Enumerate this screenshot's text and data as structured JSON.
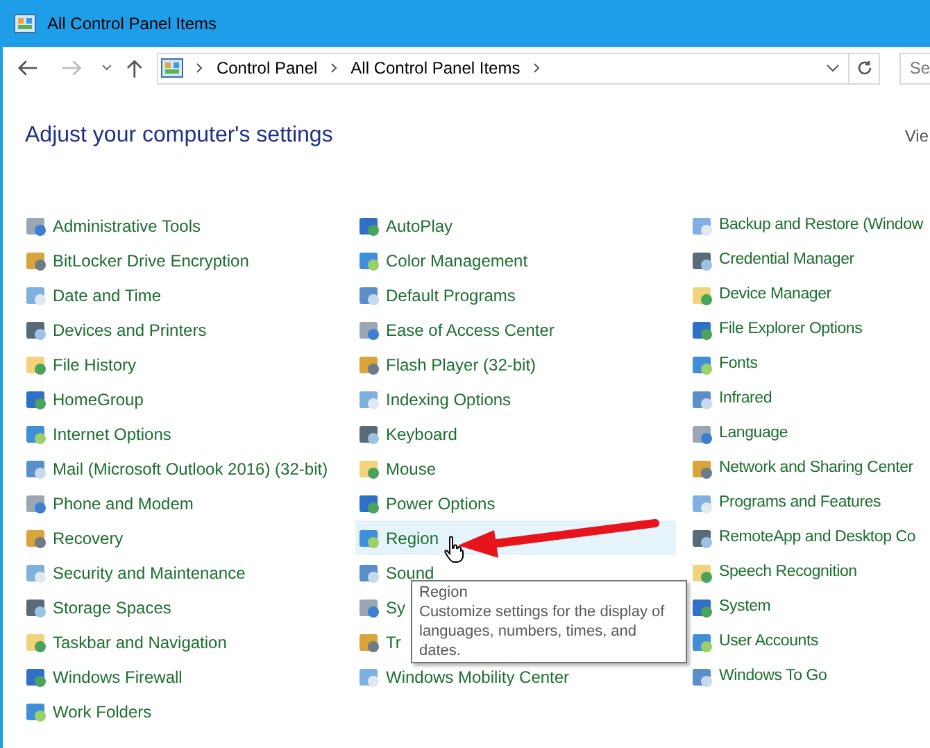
{
  "window": {
    "title": "All Control Panel Items"
  },
  "address_bar": {
    "breadcrumbs": [
      "Control Panel",
      "All Control Panel Items"
    ]
  },
  "search": {
    "placeholder": "Se"
  },
  "heading": "Adjust your computer's settings",
  "view_by": "Vie",
  "columns": [
    [
      {
        "label": "Administrative Tools",
        "selected": false
      },
      {
        "label": "BitLocker Drive Encryption",
        "selected": false
      },
      {
        "label": "Date and Time",
        "selected": false
      },
      {
        "label": "Devices and Printers",
        "selected": false
      },
      {
        "label": "File History",
        "selected": false
      },
      {
        "label": "HomeGroup",
        "selected": false
      },
      {
        "label": "Internet Options",
        "selected": false
      },
      {
        "label": "Mail (Microsoft Outlook 2016) (32-bit)",
        "selected": false
      },
      {
        "label": "Phone and Modem",
        "selected": false
      },
      {
        "label": "Recovery",
        "selected": false
      },
      {
        "label": "Security and Maintenance",
        "selected": false
      },
      {
        "label": "Storage Spaces",
        "selected": false
      },
      {
        "label": "Taskbar and Navigation",
        "selected": false
      },
      {
        "label": "Windows Firewall",
        "selected": false
      },
      {
        "label": "Work Folders",
        "selected": false
      }
    ],
    [
      {
        "label": "AutoPlay",
        "selected": false
      },
      {
        "label": "Color Management",
        "selected": false
      },
      {
        "label": "Default Programs",
        "selected": false
      },
      {
        "label": "Ease of Access Center",
        "selected": false
      },
      {
        "label": "Flash Player (32-bit)",
        "selected": false
      },
      {
        "label": "Indexing Options",
        "selected": false
      },
      {
        "label": "Keyboard",
        "selected": false
      },
      {
        "label": "Mouse",
        "selected": false
      },
      {
        "label": "Power Options",
        "selected": false
      },
      {
        "label": "Region",
        "selected": true
      },
      {
        "label": "Sound",
        "selected": false
      },
      {
        "label": "Sy",
        "selected": false
      },
      {
        "label": "Tr",
        "selected": false
      },
      {
        "label": "Windows Mobility Center",
        "selected": false
      }
    ],
    [
      {
        "label": "Backup and Restore (Window",
        "selected": false
      },
      {
        "label": "Credential Manager",
        "selected": false
      },
      {
        "label": "Device Manager",
        "selected": false
      },
      {
        "label": "File Explorer Options",
        "selected": false
      },
      {
        "label": "Fonts",
        "selected": false
      },
      {
        "label": "Infrared",
        "selected": false
      },
      {
        "label": "Language",
        "selected": false
      },
      {
        "label": "Network and Sharing Center",
        "selected": false
      },
      {
        "label": "Programs and Features",
        "selected": false
      },
      {
        "label": "RemoteApp and Desktop Co",
        "selected": false
      },
      {
        "label": "Speech Recognition",
        "selected": false
      },
      {
        "label": "System",
        "selected": false
      },
      {
        "label": "User Accounts",
        "selected": false
      },
      {
        "label": "Windows To Go",
        "selected": false
      }
    ]
  ],
  "tooltip": {
    "title": "Region",
    "text": "Customize settings for the display of languages, numbers, times, and dates."
  }
}
